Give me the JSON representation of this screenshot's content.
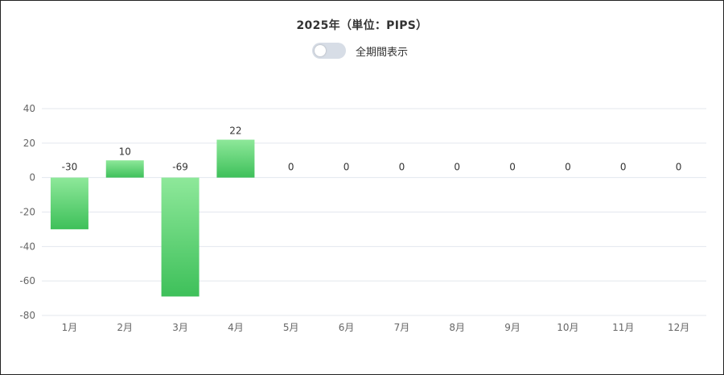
{
  "header": {
    "title": "2025年（単位：PIPS）",
    "toggle_label": "全期間表示",
    "toggle_on": false
  },
  "colors": {
    "bar_top": "#8ee89a",
    "bar_bottom": "#3ec05a",
    "grid": "#e3e7ee",
    "axis_text": "#666666",
    "label_text": "#333333"
  },
  "chart_data": {
    "type": "bar",
    "title": "2025年（単位：PIPS）",
    "categories": [
      "1月",
      "2月",
      "3月",
      "4月",
      "5月",
      "6月",
      "7月",
      "8月",
      "9月",
      "10月",
      "11月",
      "12月"
    ],
    "values": [
      -30,
      10,
      -69,
      22,
      0,
      0,
      0,
      0,
      0,
      0,
      0,
      0
    ],
    "data_labels": [
      "-30",
      "10",
      "-69",
      "22",
      "0",
      "0",
      "0",
      "0",
      "0",
      "0",
      "0",
      "0"
    ],
    "ylim": [
      -80,
      40
    ],
    "yticks": [
      40,
      20,
      0,
      -20,
      -40,
      -60,
      -80
    ],
    "grid": true,
    "legend": false,
    "xlabel": "",
    "ylabel": ""
  }
}
